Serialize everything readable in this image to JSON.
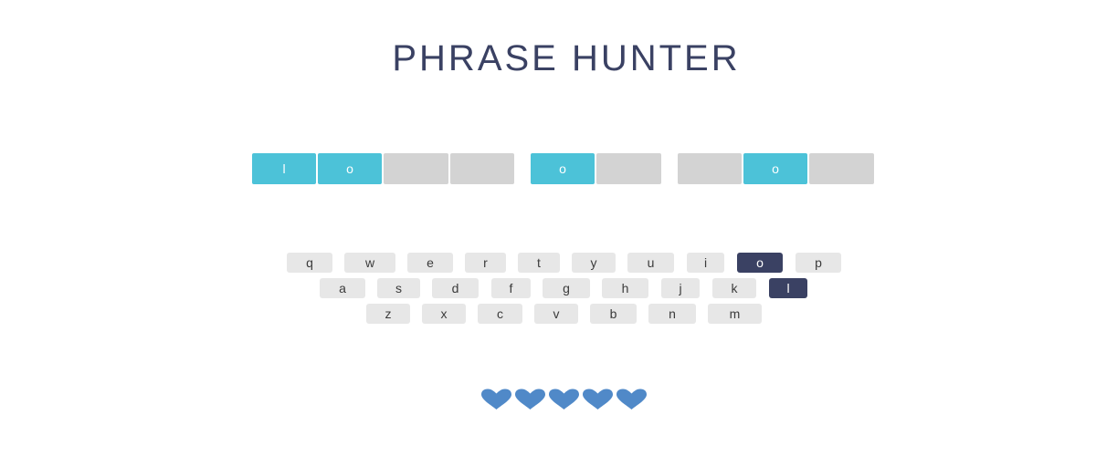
{
  "title": "PHRASE HUNTER",
  "phrase": [
    {
      "letter": "l",
      "revealed": true
    },
    {
      "letter": "o",
      "revealed": true
    },
    {
      "letter": "",
      "revealed": false
    },
    {
      "letter": "",
      "revealed": false
    },
    {
      "space": true
    },
    {
      "letter": "o",
      "revealed": true
    },
    {
      "letter": "",
      "revealed": false
    },
    {
      "space": true
    },
    {
      "letter": "",
      "revealed": false
    },
    {
      "letter": "o",
      "revealed": true
    },
    {
      "letter": "",
      "revealed": false
    }
  ],
  "keyboard": [
    [
      "q",
      "w",
      "e",
      "r",
      "t",
      "y",
      "u",
      "i",
      "o",
      "p"
    ],
    [
      "a",
      "s",
      "d",
      "f",
      "g",
      "h",
      "j",
      "k",
      "l"
    ],
    [
      "z",
      "x",
      "c",
      "v",
      "b",
      "n",
      "m"
    ]
  ],
  "chosen_keys": [
    "o",
    "l"
  ],
  "lives": 5,
  "colors": {
    "revealed_tile": "#4cc2d8",
    "hidden_tile": "#d3d3d3",
    "chosen_key": "#3a4163",
    "heart": "#5089c8"
  }
}
